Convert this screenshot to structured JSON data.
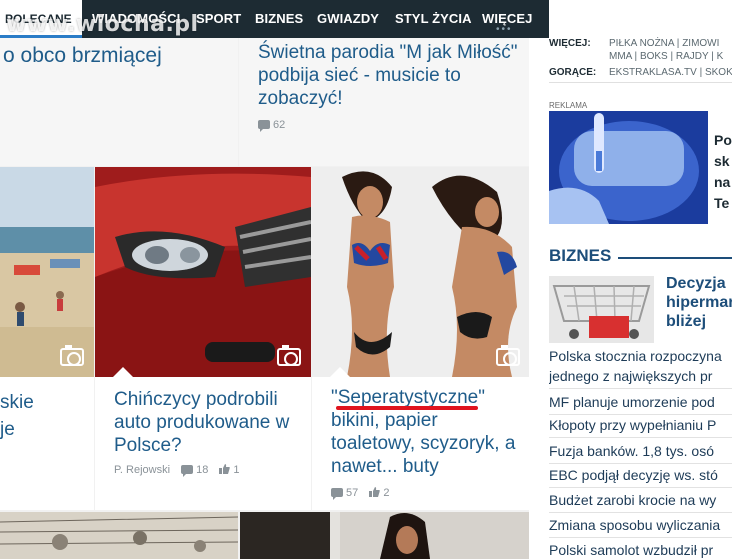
{
  "nav": {
    "active": "POLECANE",
    "items": [
      "WIADOMOŚCI",
      "SPORT",
      "BIZNES",
      "GWIAZDY",
      "STYL ŻYCIA",
      "WIĘCEJ"
    ]
  },
  "watermark": "www.wiocha.pl",
  "feed": {
    "top_left_fragment": "o obco brzmiącej",
    "top_right": {
      "title": "Świetna parodia \"M jak Miłość\" podbija sieć - musicie to zobaczyć!",
      "comments": "62"
    },
    "left_fragment_1": "skie",
    "left_fragment_2": "je",
    "car": {
      "title": "Chińczycy podrobili auto produkowane w Polsce?",
      "author": "P. Rejowski",
      "comments": "18",
      "likes": "1"
    },
    "bikini": {
      "title_quoted": "\"Seperatystyczne\"",
      "title_rest": "bikini, papier toaletowy, scyzoryk, a nawet... buty",
      "comments": "57",
      "likes": "2"
    }
  },
  "right": {
    "wiecej_label": "WIĘCEJ:",
    "wiecej_links": [
      "PIŁKA NOŻNA",
      "ZIMOWI",
      "MMA",
      "BOKS",
      "RAJDY",
      "K"
    ],
    "gorace_label": "GORĄCE:",
    "gorace_links": [
      "EKSTRAKLASA.TV",
      "SKOK"
    ],
    "ad_label": "REKLAMA",
    "ad_text": [
      "Po",
      "sk",
      "na",
      "Te"
    ],
    "section_title": "BIZNES",
    "lead_title": [
      "Decyzja",
      "hipermar",
      "bliżej"
    ],
    "list": [
      "Polska stocznia rozpoczyna",
      "jednego z największych pr",
      "MF planuje umorzenie pod",
      "Kłopoty przy wypełnianiu P",
      "Fuzja banków. 1,8 tys. osó",
      "EBC podjął decyzję ws. stó",
      "Budżet zarobi krocie na wy",
      "Zmiana sposobu wyliczania",
      "Polski samolot wzbudził pr"
    ]
  },
  "colors": {
    "nav_bg": "#1d2b33",
    "headline": "#1f5c8a",
    "underline_red": "#e0141e"
  }
}
